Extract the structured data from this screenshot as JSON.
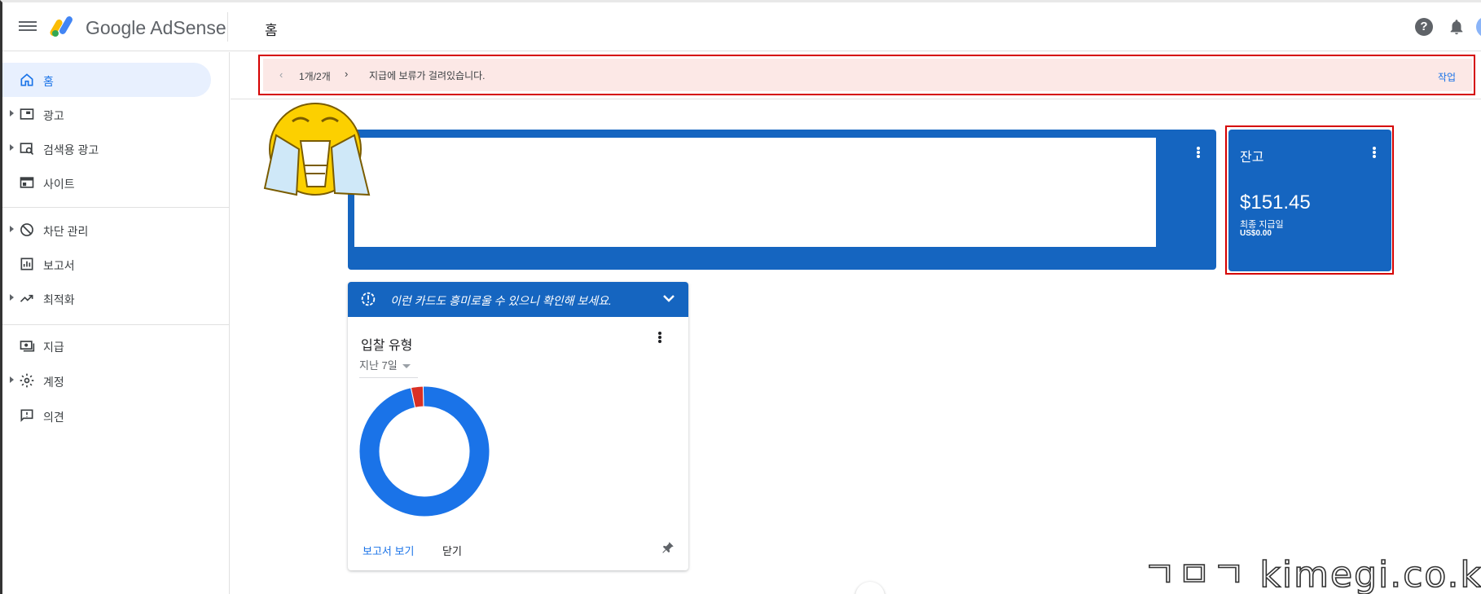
{
  "header": {
    "brand": "Google AdSense",
    "page_title": "홈"
  },
  "sidebar": {
    "items": [
      {
        "label": "홈",
        "icon": "home-icon",
        "active": true
      },
      {
        "label": "광고",
        "icon": "ad-icon"
      },
      {
        "label": "검색용 광고",
        "icon": "search-ads-icon"
      },
      {
        "label": "사이트",
        "icon": "site-icon"
      },
      {
        "label": "차단 관리",
        "icon": "block-icon"
      },
      {
        "label": "보고서",
        "icon": "report-icon"
      },
      {
        "label": "최적화",
        "icon": "trending-up-icon"
      },
      {
        "label": "지급",
        "icon": "payments-icon"
      },
      {
        "label": "계정",
        "icon": "gear-icon"
      },
      {
        "label": "의견",
        "icon": "feedback-icon"
      }
    ]
  },
  "banner": {
    "counter": "1개/2개",
    "message": "지급에 보류가 걸려있습니다.",
    "action": "작업"
  },
  "balance_card": {
    "title": "잔고",
    "amount": "$151.45",
    "last_payment_label": "최종 지급일",
    "last_payment_amount": "US$0.00"
  },
  "notice_card": {
    "notice": "이런 카드도 흥미로울 수 있으니 확인해 보세요.",
    "title": "입찰 유형",
    "range": "지난 7일",
    "view_report": "보고서 보기",
    "close": "닫기"
  },
  "chart_data": {
    "type": "pie",
    "title": "입찰 유형",
    "slices": [
      {
        "share": 0.97,
        "color": "#1a73e8"
      },
      {
        "share": 0.03,
        "color": "#d93025"
      }
    ]
  },
  "watermark": "ㄱㅁㄱ kimegi.co.kr",
  "colors": {
    "primary": "#1565c0",
    "link": "#1a73e8",
    "alert_bg": "#fce8e6",
    "highlight": "#d50000"
  }
}
